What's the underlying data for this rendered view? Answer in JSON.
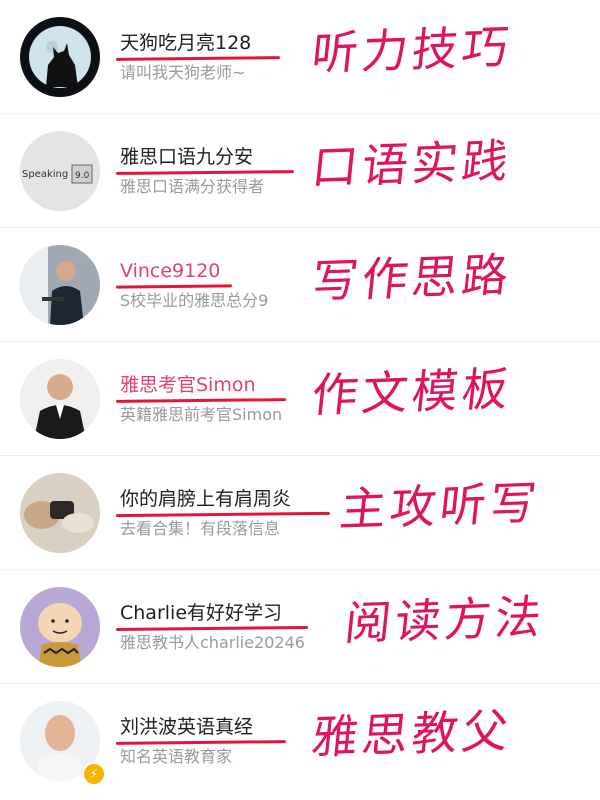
{
  "accounts": [
    {
      "name": "天狗吃月亮128",
      "bio": "请叫我天狗老师~",
      "note": "听力技巧",
      "avatar_icon": "moon-wolf-icon"
    },
    {
      "name": "雅思口语九分安",
      "bio": "雅思口语满分获得者",
      "note": "口语实践",
      "avatar_icon": "speaking-score-icon",
      "avatar_text": "Speaking",
      "avatar_score": "9.0"
    },
    {
      "name": "Vince9120",
      "bio": "S校毕业的雅思总分9",
      "note": "写作思路",
      "avatar_icon": "teacher-photo-icon"
    },
    {
      "name": "雅思考官Simon",
      "bio": "英籍雅思前考官Simon",
      "note": "作文模板",
      "avatar_icon": "examiner-photo-icon"
    },
    {
      "name": "你的肩膀上有肩周炎",
      "bio": "去看合集！有段落信息",
      "note": "主攻听写",
      "avatar_icon": "blurred-photo-icon"
    },
    {
      "name": "Charlie有好好学习",
      "bio": "雅思教书人charlie20246",
      "note": "阅读方法",
      "avatar_icon": "charlie-brown-icon"
    },
    {
      "name": "刘洪波英语真经",
      "bio": "知名英语教育家",
      "note": "雅思教父",
      "avatar_icon": "portrait-photo-icon",
      "badge_icon": "lightning-badge-icon",
      "badge_glyph": "⚡"
    }
  ],
  "colors": {
    "annotation": "#e0135e",
    "underline": "#e8133b",
    "name_pink": "#e63f6e"
  }
}
